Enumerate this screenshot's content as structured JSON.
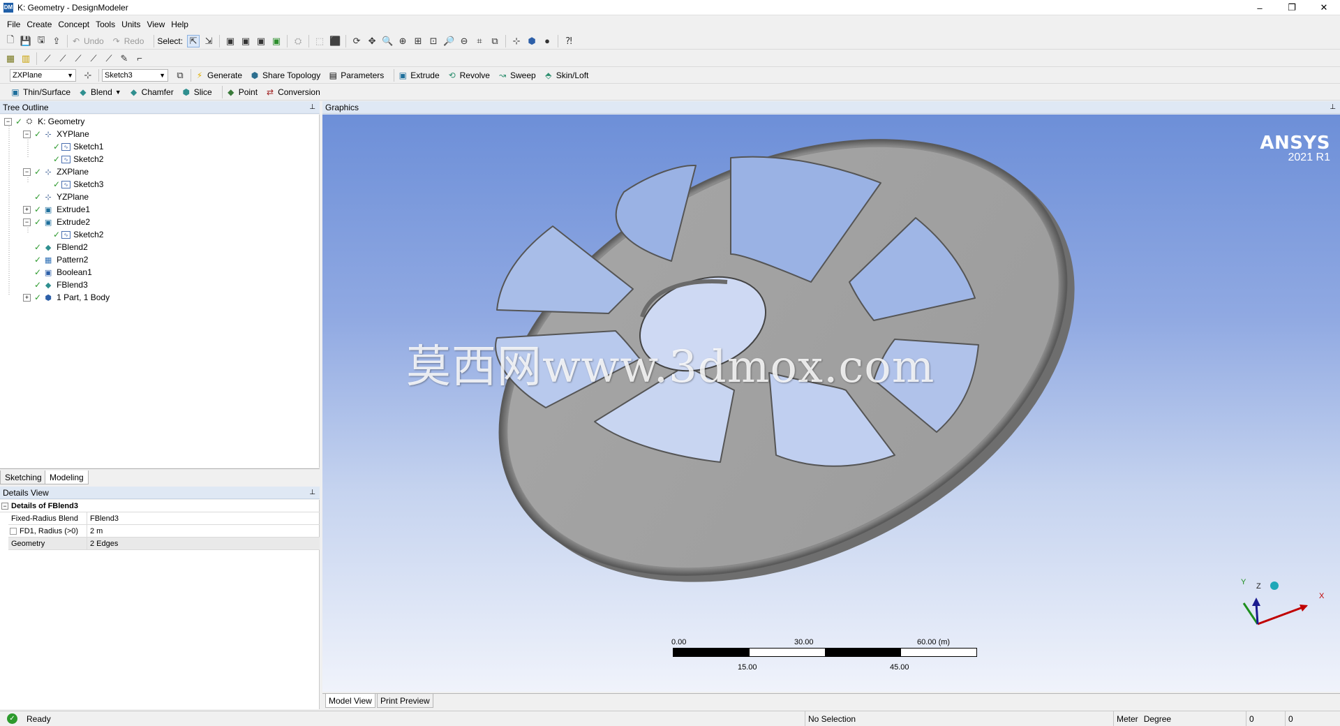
{
  "window": {
    "app_icon_text": "DM",
    "title": "K: Geometry - DesignModeler",
    "minimize_glyph": "–",
    "restore_glyph": "❐",
    "close_glyph": "✕"
  },
  "menu": [
    "File",
    "Create",
    "Concept",
    "Tools",
    "Units",
    "View",
    "Help"
  ],
  "toolbar1": {
    "undo_label": "Undo",
    "redo_label": "Redo",
    "select_label": "Select:"
  },
  "toolbar3": {
    "plane_combo": "ZXPlane",
    "sketch_combo": "Sketch3",
    "generate_label": "Generate",
    "share_topology_label": "Share Topology",
    "parameters_label": "Parameters",
    "extrude_label": "Extrude",
    "revolve_label": "Revolve",
    "sweep_label": "Sweep",
    "skin_loft_label": "Skin/Loft"
  },
  "toolbar4": {
    "thin_surface_label": "Thin/Surface",
    "blend_label": "Blend",
    "chamfer_label": "Chamfer",
    "slice_label": "Slice",
    "point_label": "Point",
    "conversion_label": "Conversion"
  },
  "tree_outline": {
    "header": "Tree Outline",
    "pin_glyph": "⊥",
    "items": [
      {
        "label": "K: Geometry",
        "icon": "geometry-icon"
      },
      {
        "label": "XYPlane",
        "icon": "plane-icon"
      },
      {
        "label": "Sketch1",
        "icon": "sketch-icon"
      },
      {
        "label": "Sketch2",
        "icon": "sketch-icon"
      },
      {
        "label": "ZXPlane",
        "icon": "plane-icon"
      },
      {
        "label": "Sketch3",
        "icon": "sketch-icon"
      },
      {
        "label": "YZPlane",
        "icon": "plane-icon"
      },
      {
        "label": "Extrude1",
        "icon": "extrude-icon"
      },
      {
        "label": "Extrude2",
        "icon": "extrude-icon"
      },
      {
        "label": "Sketch2",
        "icon": "sketch-icon"
      },
      {
        "label": "FBlend2",
        "icon": "blend-icon"
      },
      {
        "label": "Pattern2",
        "icon": "pattern-icon"
      },
      {
        "label": "Boolean1",
        "icon": "boolean-icon"
      },
      {
        "label": "FBlend3",
        "icon": "blend-icon"
      },
      {
        "label": "1 Part, 1 Body",
        "icon": "body-icon"
      }
    ]
  },
  "mode_tabs": {
    "sketching": "Sketching",
    "modeling": "Modeling"
  },
  "details_view": {
    "header": "Details View",
    "title": "Details of FBlend3",
    "rows": [
      {
        "key": "Fixed-Radius Blend",
        "value": "FBlend3"
      },
      {
        "key": "FD1, Radius (>0)",
        "value": "2 m"
      },
      {
        "key": "Geometry",
        "value": "2 Edges"
      }
    ]
  },
  "graphics": {
    "header": "Graphics",
    "logo_name": "ANSYS",
    "logo_version": "2021 R1",
    "watermark": "莫西网www.3dmox.com",
    "scale": {
      "t0": "0.00",
      "t30": "30.00",
      "t60": "60.00 (m)",
      "t15": "15.00",
      "t45": "45.00"
    },
    "triad": {
      "x": "X",
      "y": "Y",
      "z": "Z"
    },
    "tabs": {
      "model_view": "Model View",
      "print_preview": "Print Preview"
    }
  },
  "status_bar": {
    "ready": "Ready",
    "selection": "No Selection",
    "unit_length": "Meter",
    "unit_angle": "Degree",
    "coord1": "0",
    "coord2": "0"
  },
  "colors": {
    "accent": "#1f5fa8",
    "background_top": "#6d8fd8",
    "part": "#a3a3a3"
  }
}
